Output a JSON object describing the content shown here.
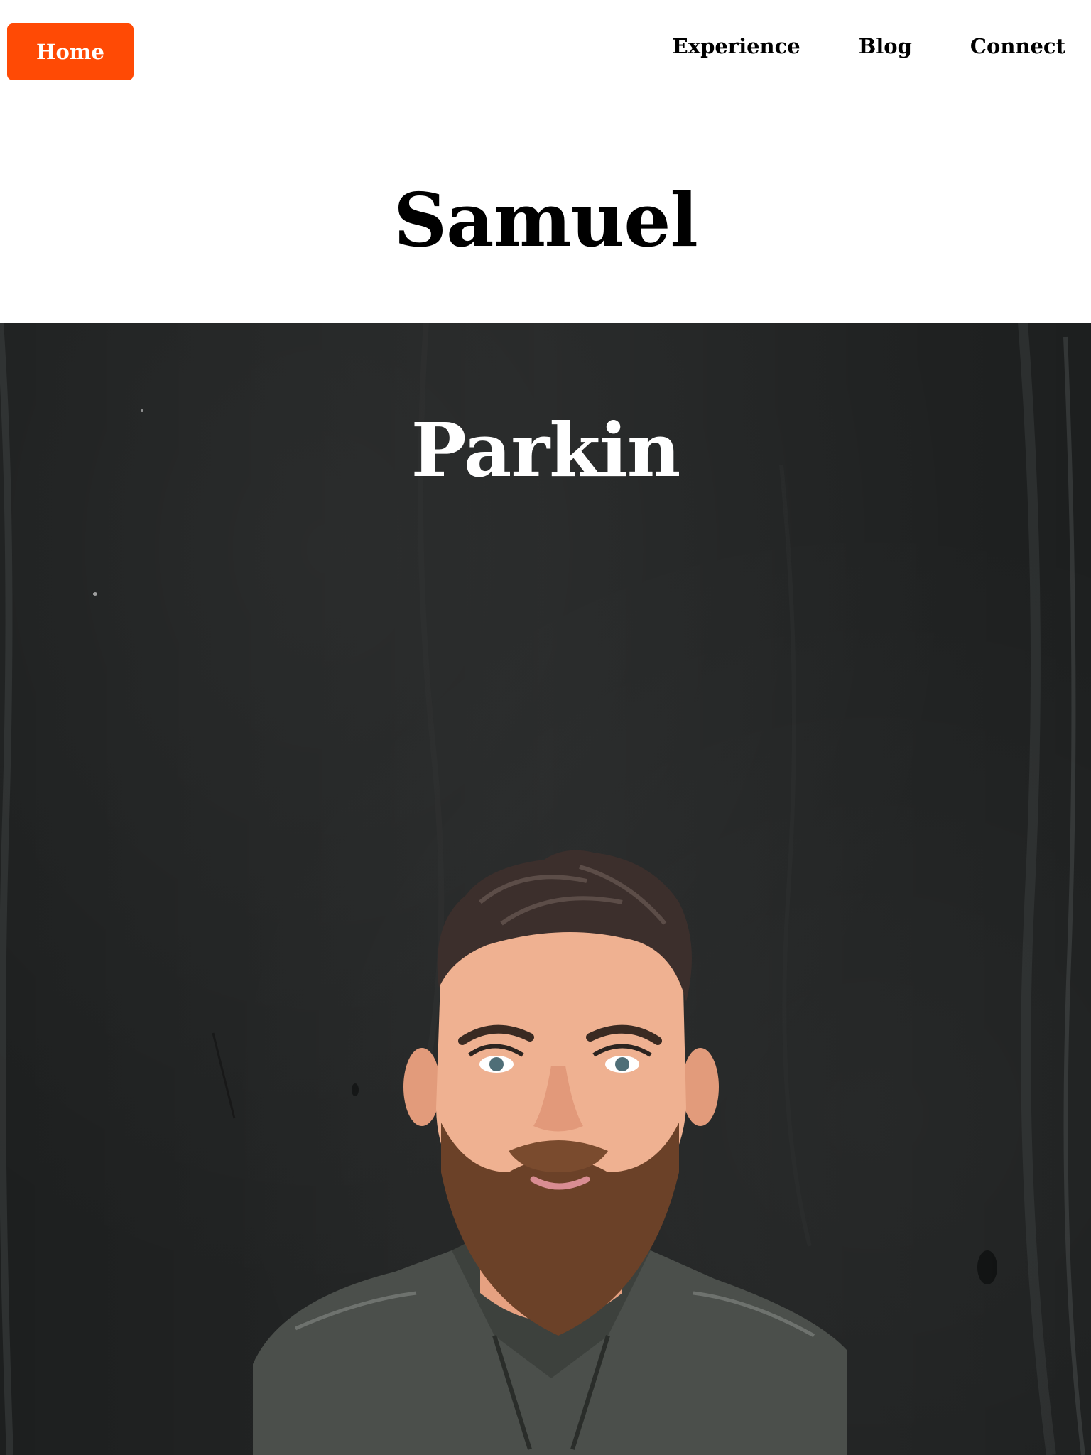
{
  "nav": {
    "home_label": "Home",
    "links": [
      "Experience",
      "Blog",
      "Connect"
    ]
  },
  "hero": {
    "first_name": "Samuel",
    "last_name": "Parkin",
    "portrait_icon": "portrait-illustration"
  },
  "colors": {
    "accent": "#ff4a05",
    "hero_background": "#1d1f1f",
    "heading_dark": "#000000",
    "heading_light": "#ffffff"
  }
}
